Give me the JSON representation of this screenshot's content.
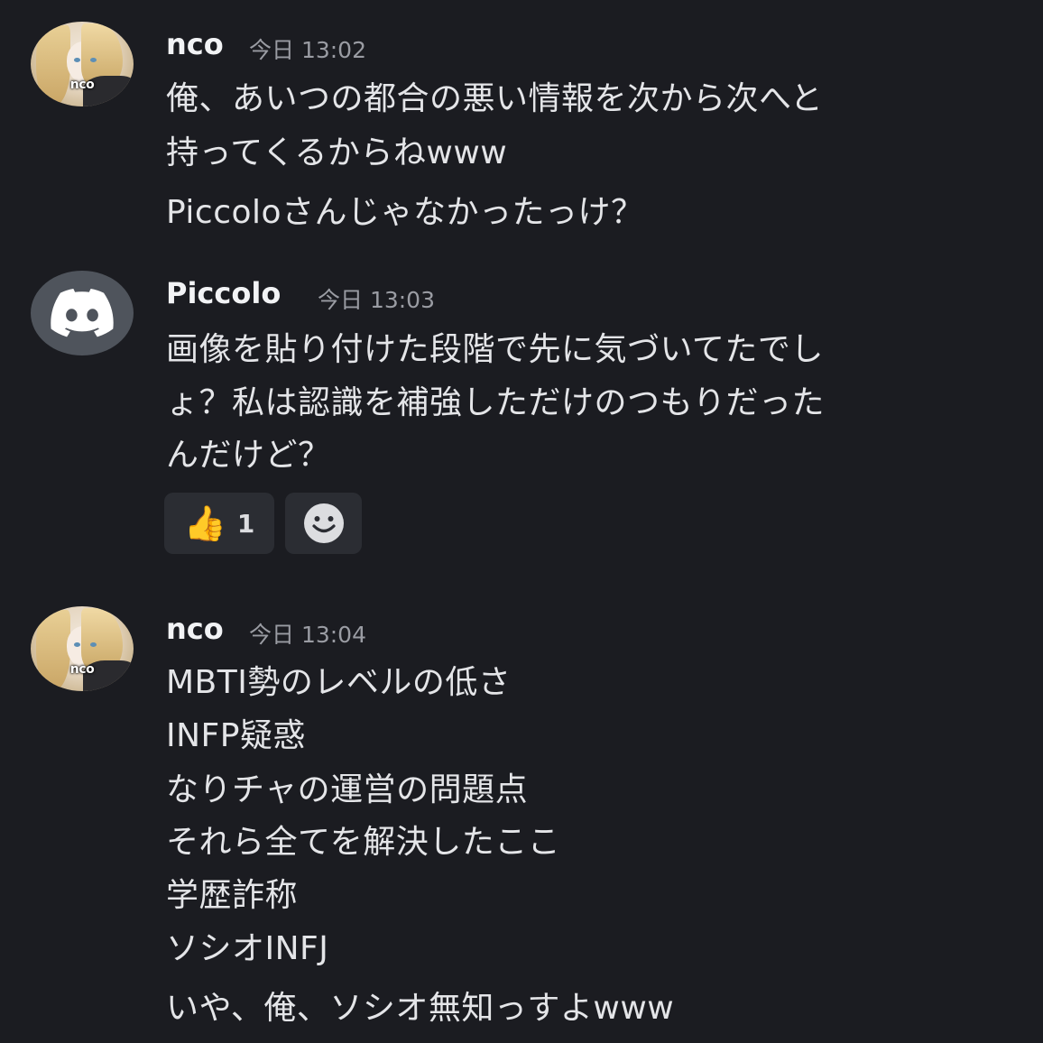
{
  "messages": [
    {
      "author": "nco",
      "avatar_icon": "anime-girl-avatar-icon",
      "avatar_label": "nco",
      "timestamp": "今日 13:02",
      "lines": [
        "俺、あいつの都合の悪い情報を次から次へと",
        "持ってくるからねwww",
        "Piccoloさんじゃなかったっけ？"
      ]
    },
    {
      "author": "Piccolo",
      "avatar_icon": "discord-logo-icon",
      "timestamp": "今日 13:03",
      "lines": [
        "画像を貼り付けた段階で先に気づいてたでし",
        "ょ？私は認識を補強しただけのつもりだった",
        "んだけど？"
      ],
      "reactions": [
        {
          "icon": "thumbs-up-icon",
          "emoji": "👍",
          "count": "1"
        },
        {
          "icon": "add-reaction-smiley-icon"
        }
      ]
    },
    {
      "author": "nco",
      "avatar_icon": "anime-girl-avatar-icon",
      "avatar_label": "nco",
      "timestamp": "今日 13:04",
      "lines": [
        "MBTI勢のレベルの低さ",
        "INFP疑惑",
        "なりチャの運営の問題点",
        "それら全てを解決したここ",
        "学歴詐称",
        "ソシオINFJ",
        "いや、俺、ソシオ無知っすよwww"
      ]
    }
  ],
  "colors": {
    "background": "#1b1c21",
    "text": "#e4e5e8",
    "muted": "#9a9ca3",
    "reaction_bg": "#2b2d33",
    "discord_avatar_bg": "#4f545c"
  }
}
